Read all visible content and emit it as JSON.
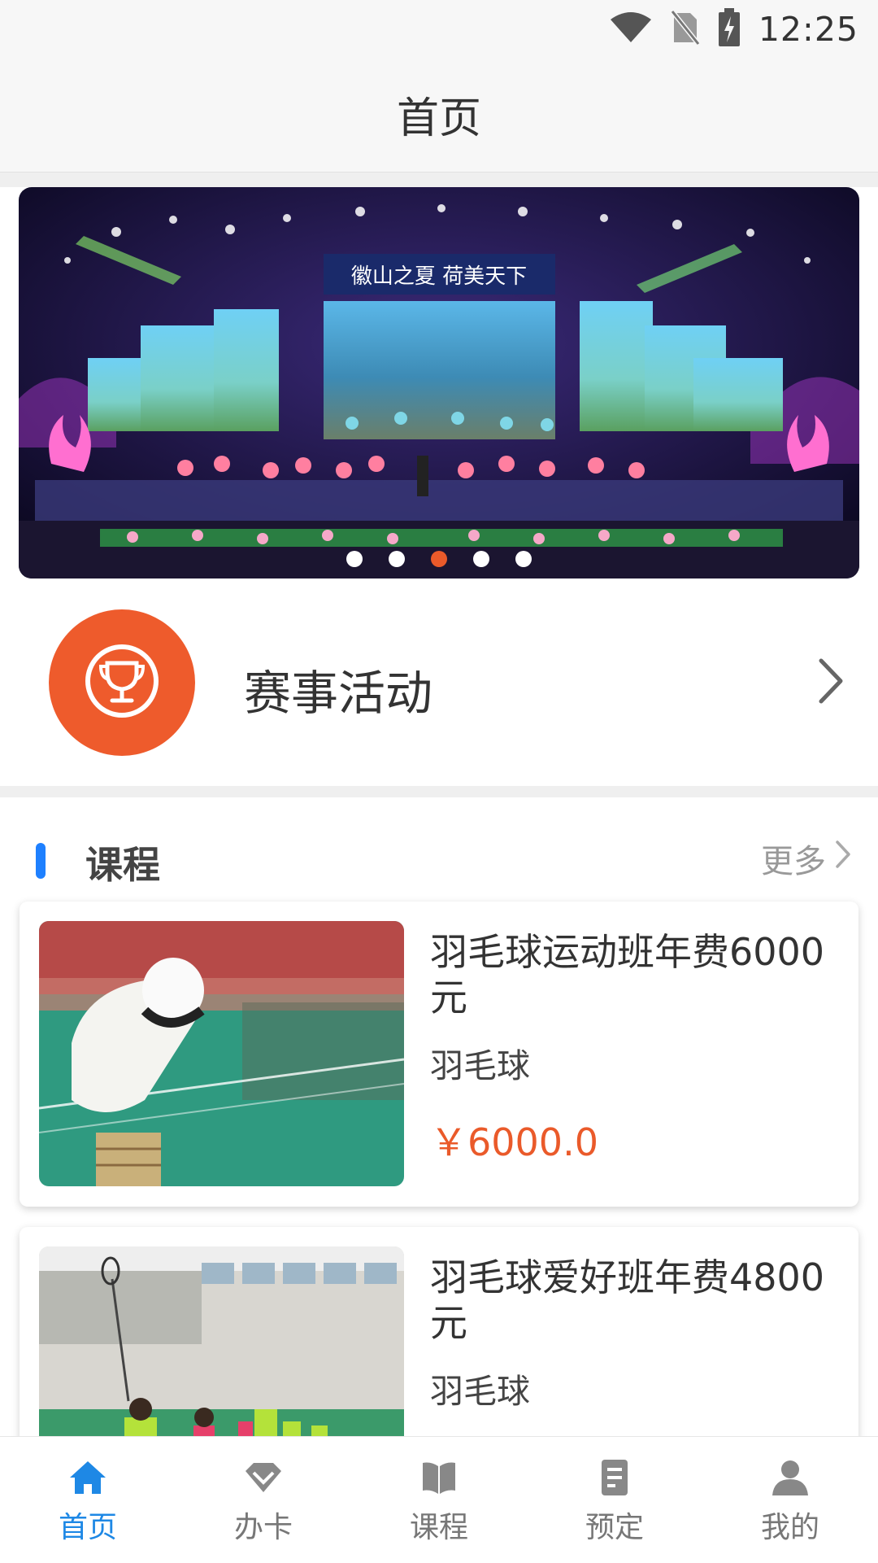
{
  "status_bar": {
    "time": "12:25",
    "icons": [
      "wifi-icon",
      "no-sim-icon",
      "battery-charging-icon"
    ]
  },
  "header": {
    "title": "首页"
  },
  "banner": {
    "image_text": "徽山之夏 荷美天下",
    "dots": 5,
    "active_dot": 3
  },
  "event": {
    "label": "赛事活动",
    "icon": "trophy-icon"
  },
  "courses_section": {
    "title": "课程",
    "more_label": "更多"
  },
  "courses": [
    {
      "title": "羽毛球运动班年费6000元",
      "category": "羽毛球",
      "price": "￥6000.0"
    },
    {
      "title": "羽毛球爱好班年费4800元",
      "category": "羽毛球"
    }
  ],
  "tabbar": {
    "items": [
      {
        "label": "首页",
        "icon": "home-icon",
        "active": true
      },
      {
        "label": "办卡",
        "icon": "diamond-icon",
        "active": false
      },
      {
        "label": "课程",
        "icon": "book-icon",
        "active": false
      },
      {
        "label": "预定",
        "icon": "document-icon",
        "active": false
      },
      {
        "label": "我的",
        "icon": "person-icon",
        "active": false
      }
    ]
  },
  "colors": {
    "accent_orange": "#ee5b2c",
    "accent_blue": "#1e88e5",
    "section_bar": "#1e80ff"
  }
}
